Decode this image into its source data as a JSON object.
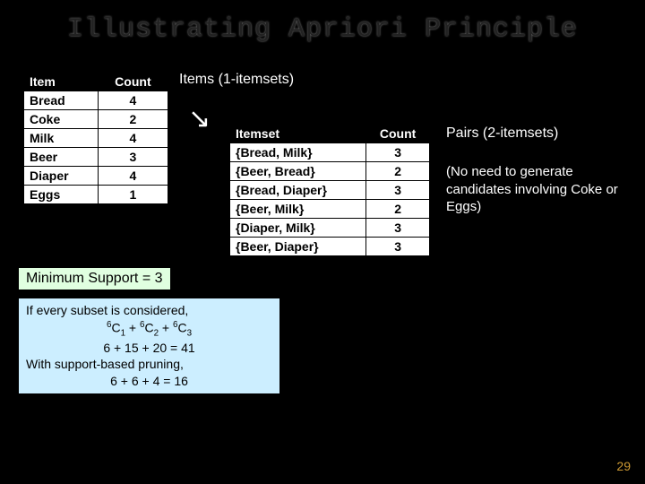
{
  "title": "Illustrating Apriori Principle",
  "labels": {
    "items": "Items (1-itemsets)",
    "pairs": "Pairs (2-itemsets)",
    "note": "(No need to generate candidates involving Coke or Eggs)",
    "minsup": "Minimum Support = 3"
  },
  "table1": {
    "h1": "Item",
    "h2": "Count",
    "rows": [
      {
        "item": "Bread",
        "count": "4"
      },
      {
        "item": "Coke",
        "count": "2"
      },
      {
        "item": "Milk",
        "count": "4"
      },
      {
        "item": "Beer",
        "count": "3"
      },
      {
        "item": "Diaper",
        "count": "4"
      },
      {
        "item": "Eggs",
        "count": "1"
      }
    ]
  },
  "table2": {
    "h1": "Itemset",
    "h2": "Count",
    "rows": [
      {
        "item": "{Bread, Milk}",
        "count": "3"
      },
      {
        "item": "{Beer, Bread}",
        "count": "2"
      },
      {
        "item": "{Bread, Diaper}",
        "count": "3"
      },
      {
        "item": "{Beer, Milk}",
        "count": "2"
      },
      {
        "item": "{Diaper, Milk}",
        "count": "3"
      },
      {
        "item": "{Beer, Diaper}",
        "count": "3"
      }
    ]
  },
  "calc": {
    "l1": "If every subset is considered,",
    "l3": "6 + 15 + 20 = 41",
    "l4": "With support-based pruning,",
    "l5": "6 + 6 + 4 = 16",
    "comb": {
      "n": "6",
      "c": "C",
      "k1": "1",
      "k2": "2",
      "k3": "3",
      "plus": " + "
    }
  },
  "arrow": "↘",
  "slidenum": "29"
}
